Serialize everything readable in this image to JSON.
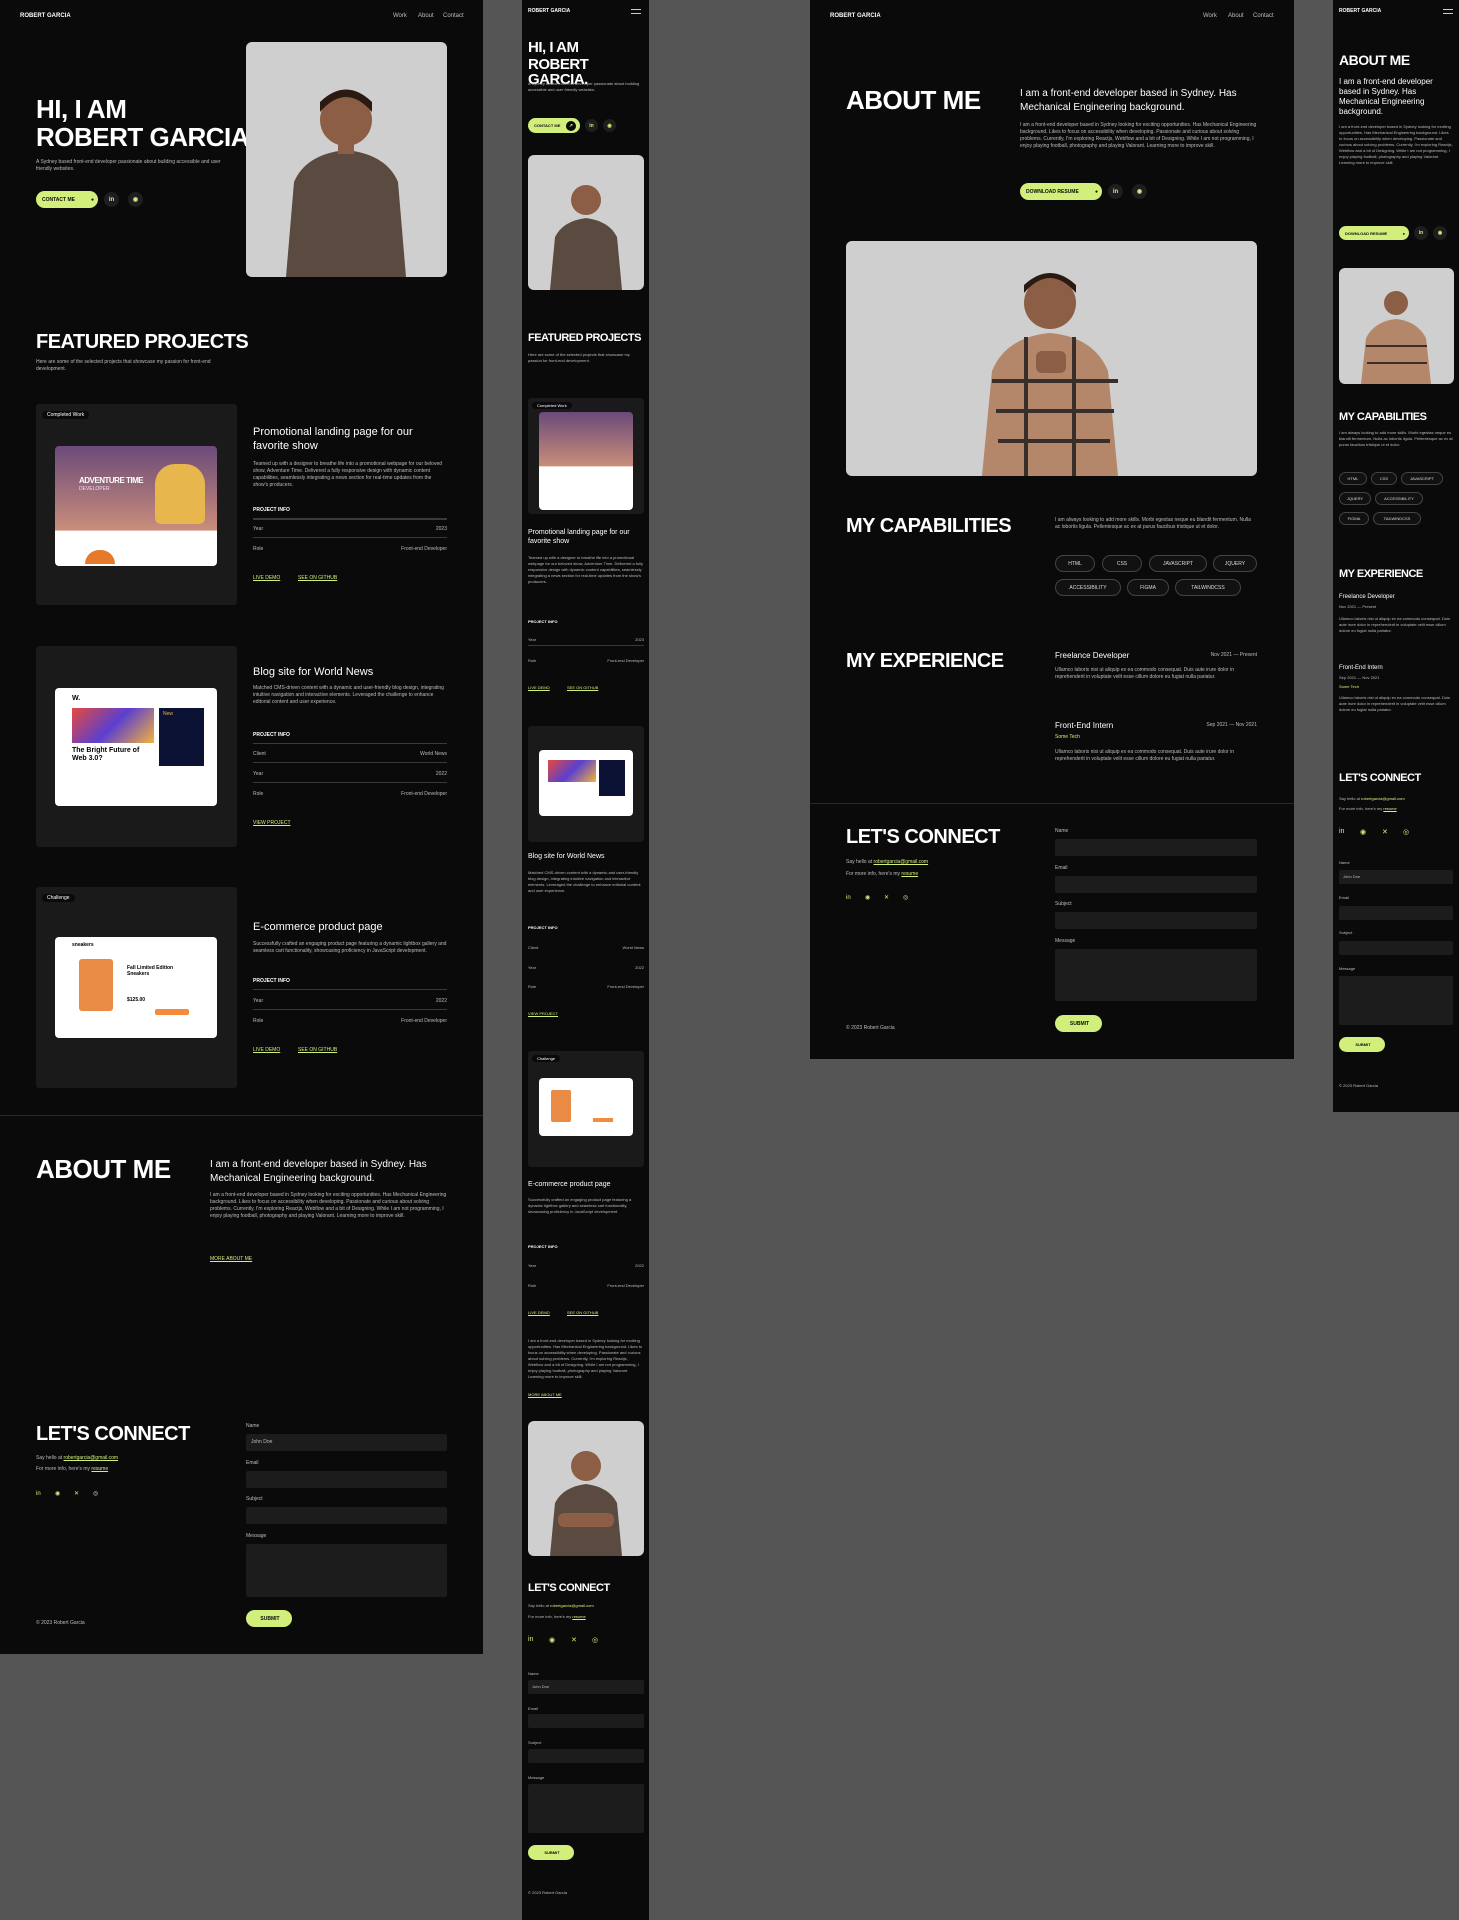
{
  "brand": "ROBERT GARCIA",
  "nav": {
    "work": "Work",
    "about": "About",
    "contact": "Contact"
  },
  "hero": {
    "greeting": "HI, I AM",
    "name": "ROBERT GARCIA.",
    "intro": "A Sydney based front-end developer passionate about building accessible and user friendly websites.",
    "contact_label": "CONTACT ME"
  },
  "featured": {
    "title": "FEATURED PROJECTS",
    "intro": "Here are some of the selected projects that showcase my passion for front-end development.",
    "projects": [
      {
        "tag": "Completed Work",
        "title": "Promotional landing page for our favorite show",
        "desc": "Teamed up with a designer to breathe life into a promotional webpage for our beloved show, Adventure Time. Delivered a fully responsive design with dynamic content capabilities, seamlessly integrating a news section for real-time updates from the show's producers.",
        "info_label": "PROJECT INFO",
        "rows": [
          {
            "k": "Year",
            "v": "2023"
          },
          {
            "k": "Role",
            "v": "Front-end Developer"
          }
        ],
        "links": [
          "LIVE DEMO",
          "SEE ON GITHUB"
        ]
      },
      {
        "tag": "",
        "title": "Blog site for World News",
        "desc": "Matched CMS-driven content with a dynamic and user-friendly blog design, integrating intuitive navigation and interactive elements. Leveraged the challenge to enhance editorial content and user experience.",
        "info_label": "PROJECT INFO",
        "rows": [
          {
            "k": "Client",
            "v": "World News"
          },
          {
            "k": "Year",
            "v": "2022"
          },
          {
            "k": "Role",
            "v": "Front-end Developer"
          }
        ],
        "links": [
          "VIEW PROJECT"
        ]
      },
      {
        "tag": "Challenge",
        "title": "E-commerce product page",
        "desc": "Successfully crafted an engaging product page featuring a dynamic lightbox gallery and seamless cart functionality, showcasing proficiency in JavaScript development.",
        "info_label": "PROJECT INFO",
        "rows": [
          {
            "k": "Year",
            "v": "2022"
          },
          {
            "k": "Role",
            "v": "Front-end Developer"
          }
        ],
        "links": [
          "LIVE DEMO",
          "SEE ON GITHUB"
        ]
      }
    ]
  },
  "about": {
    "title": "ABOUT ME",
    "headline": "I am a front-end developer based in Sydney. Has Mechanical Engineering background.",
    "body": "I am a front-end developer based in Sydney looking for exciting opportunities. Has Mechanical Engineering background. Likes to focus on accessibility when developing. Passionate and curious about solving problems. Currently, I'm exploring Reactjs, Webflow and a bit of Designing. While I am not programming, I enjoy playing football, photography and playing Valorant. Learning more to improve skill.",
    "more_label": "MORE ABOUT ME",
    "resume_label": "DOWNLOAD RESUME"
  },
  "capabilities": {
    "title": "MY CAPABILITIES",
    "intro": "I am always looking to add more skills. Morbi egestas neque eu blandit fermentum. Nulla ac lobortis ligula. Pellentesque ac ex at purus faucibus tristique ut et dolor.",
    "skills": [
      "HTML",
      "CSS",
      "JAVASCRIPT",
      "JQUERY",
      "ACCESSIBILITY",
      "FIGMA",
      "TAILWINDCSS"
    ]
  },
  "experience": {
    "title": "MY EXPERIENCE",
    "jobs": [
      {
        "role": "Freelance Developer",
        "dates": "Nov 2021 — Present",
        "company": "",
        "desc": "Ullamco laboris nisi ut aliquip ex ea commodo consequat. Duis aute irure dolor in reprehenderit in voluptate velit esse cillum dolore eu fugiat nulla pariatur."
      },
      {
        "role": "Front-End Intern",
        "dates": "Sep 2021 — Nov 2021",
        "company": "Some Tech",
        "desc": "Ullamco laboris nisi ut aliquip ex ea commodo consequat. Duis aute irure dolor in reprehenderit in voluptate velit esse cillum dolore eu fugiat nulla pariatur."
      }
    ]
  },
  "connect": {
    "title": "LET'S CONNECT",
    "say_hello": "Say hello at",
    "email": "robertgarcia@gmail.com",
    "resume_pre": "For more info, here's my",
    "resume": "resume",
    "fields": {
      "name": "Name",
      "email": "Email",
      "subject": "Subject",
      "message": "Message"
    },
    "name_value": "John Doe",
    "submit": "SUBMIT"
  },
  "footer": "© 2023 Robert Garcia",
  "screens": {
    "adventure_title": "ADVENTURE TIME",
    "adventure_sub": "DEVELOPER",
    "blog_brand": "W.",
    "blog_headline": "The Bright Future of Web 3.0?",
    "blog_side": "New",
    "shop_brand": "sneakers",
    "shop_title": "Fall Limited Edition Sneakers",
    "shop_price": "$125.00"
  },
  "colors": {
    "accent": "#d3ef7b",
    "bg": "#0a0a0a",
    "card": "#1a1a1a",
    "canvas": "#555555"
  }
}
